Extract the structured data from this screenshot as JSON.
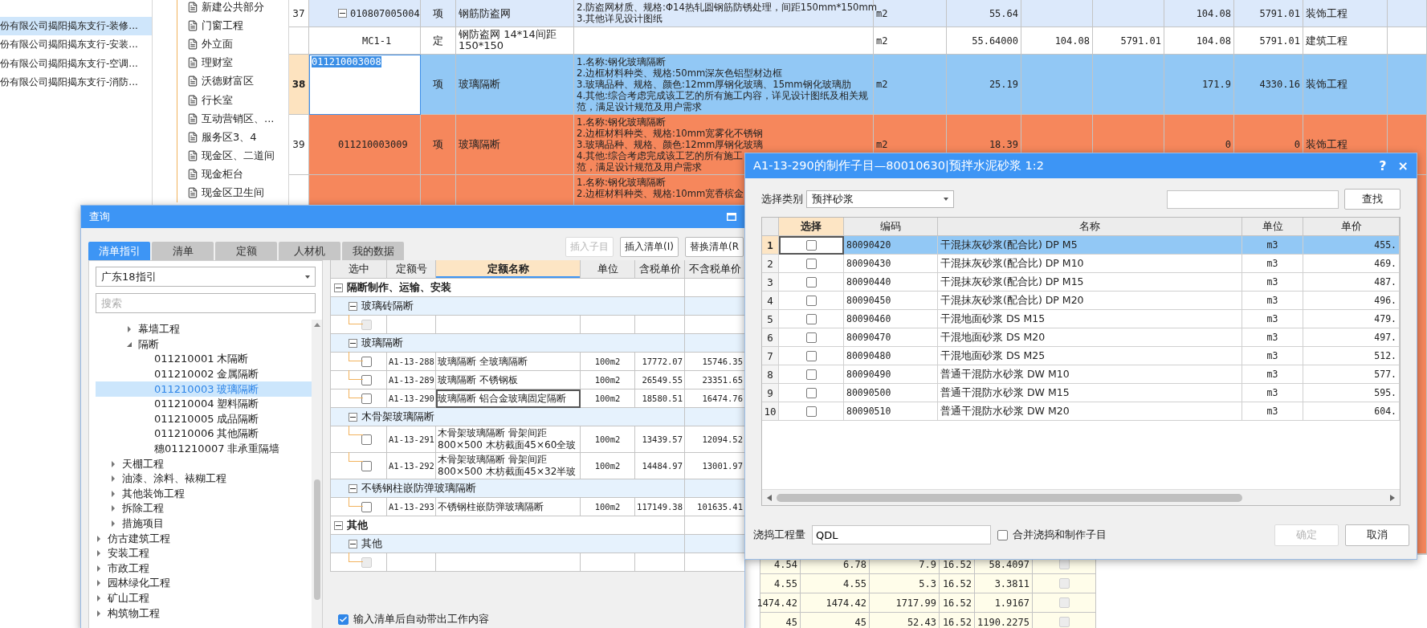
{
  "project_list": {
    "items": [
      {
        "label": "份有限公司揭阳揭东支行-装修...",
        "selected": true
      },
      {
        "label": "份有限公司揭阳揭东支行-安装...",
        "selected": false
      },
      {
        "label": "份有限公司揭阳揭东支行-空调...",
        "selected": false
      },
      {
        "label": "份有限公司揭阳揭东支行-消防...",
        "selected": false
      }
    ]
  },
  "section_tree": {
    "items": [
      "新建公共部分",
      "门窗工程",
      "外立面",
      "理财室",
      "沃德财富区",
      "行长室",
      "互动营销区、...",
      "服务区3、4",
      "现金区、二道间",
      "现金柜台",
      "现金区卫生间"
    ]
  },
  "bill_table": {
    "rows": [
      {
        "number": "37",
        "kind": "bill",
        "expanded": true,
        "selected": false,
        "color": "#dce9fb",
        "code": "010807005004",
        "type": "项",
        "name": "钢筋防盗网",
        "description": [
          "2.防盗网材质、规格:Φ14热轧圆钢筋防锈处理，间距150mm*150mm",
          "3.其他详见设计图纸"
        ],
        "unit": "m2",
        "quantity": "55.64",
        "column_10": "104.08",
        "column_11": "5791.01",
        "category": "装饰工程"
      },
      {
        "kind": "quota",
        "selected": false,
        "color": "#ffffff",
        "code": "MC1-1",
        "type": "定",
        "name": "钢防盗网 14*14间距 150*150",
        "description": [],
        "unit": "m2",
        "quantity": "55.64000",
        "column_8": "104.08",
        "column_9": "5791.01",
        "column_10": "104.08",
        "column_11": "5791.01",
        "category": "建筑工程"
      },
      {
        "number": "38",
        "kind": "bill",
        "selected": true,
        "color": "#92c8f5",
        "code": "011210003008",
        "type": "项",
        "name": "玻璃隔断",
        "description": [
          "1.名称:钢化玻璃隔断",
          "2.边框材料种类、规格:50mm深灰色铝型材边框",
          "3.玻璃品种、规格、颜色:12mm厚钢化玻璃、15mm钢化玻璃肋",
          "4.其他:综合考虑完成该工艺的所有施工内容，详见设计图纸及相关规",
          "范，满足设计规范及用户需求"
        ],
        "unit": "m2",
        "quantity": "25.19",
        "column_10": "171.9",
        "column_11": "4330.16",
        "category": "装饰工程"
      },
      {
        "number": "39",
        "kind": "bill",
        "selected": false,
        "color": "#f6875c",
        "code": "011210003009",
        "type": "项",
        "name": "玻璃隔断",
        "description": [
          "1.名称:钢化玻璃隔断",
          "2.边框材料种类、规格:10mm宽雾化不锈钢",
          "3.玻璃品种、规格、颜色:12mm厚钢化玻璃",
          "4.其他:综合考虑完成该工艺的所有施工",
          "范，满足设计规范及用户需求"
        ],
        "unit": "m2",
        "quantity": "18.39",
        "column_10": "0",
        "column_11": "0",
        "category": "装饰工程"
      },
      {
        "kind": "bill",
        "selected": false,
        "color": "#f6875c",
        "description": [
          "1.名称:钢化玻璃隔断",
          "2.边框材料种类、规格:10mm宽香槟金"
        ]
      }
    ]
  },
  "query_dialog": {
    "title": "查询",
    "tabs": [
      {
        "label": "清单指引",
        "selected": true
      },
      {
        "label": "清单",
        "selected": false
      },
      {
        "label": "定额",
        "selected": false
      },
      {
        "label": "人材机",
        "selected": false
      },
      {
        "label": "我的数据",
        "selected": false
      }
    ],
    "buttons": [
      {
        "label": "插入子目",
        "disabled": true
      },
      {
        "label": "插入清单(I)",
        "disabled": false
      },
      {
        "label": "替换清单(R",
        "disabled": false
      }
    ],
    "guide_select": "广东18指引",
    "search": {
      "placeholder": "搜索"
    },
    "tree": {
      "items": [
        {
          "children": [
            {
              "children": [
                {
                  "label": "幕墙工程",
                  "expanded": false,
                  "selected": false
                },
                {
                  "label": "隔断",
                  "expanded": true,
                  "selected": false,
                  "children": [
                    {
                      "code": "011210001",
                      "label": "木隔断",
                      "selected": false
                    },
                    {
                      "code": "011210002",
                      "label": "金属隔断",
                      "selected": false
                    },
                    {
                      "code": "011210003",
                      "label": "玻璃隔断",
                      "selected": true
                    },
                    {
                      "code": "011210004",
                      "label": "塑料隔断",
                      "selected": false
                    },
                    {
                      "code": "011210005",
                      "label": "成品隔断",
                      "selected": false
                    },
                    {
                      "code": "011210006",
                      "label": "其他隔断",
                      "selected": false
                    },
                    {
                      "code": "穗011210007",
                      "label": "非承重隔墙",
                      "selected": false
                    }
                  ]
                }
              ]
            },
            {
              "label": "天棚工程",
              "expanded": false,
              "selected": false
            },
            {
              "label": "油漆、涂料、裱糊工程",
              "expanded": false,
              "selected": false
            },
            {
              "label": "其他装饰工程",
              "expanded": false,
              "selected": false
            },
            {
              "label": "拆除工程",
              "expanded": false,
              "selected": false
            },
            {
              "label": "措施项目",
              "expanded": false,
              "selected": false
            }
          ]
        },
        {
          "label": "仿古建筑工程",
          "expanded": false,
          "selected": false
        },
        {
          "label": "安装工程",
          "expanded": false,
          "selected": false
        },
        {
          "label": "市政工程",
          "expanded": false,
          "selected": false
        },
        {
          "label": "园林绿化工程",
          "expanded": false,
          "selected": false
        },
        {
          "label": "矿山工程",
          "expanded": false,
          "selected": false
        },
        {
          "label": "构筑物工程",
          "expanded": false,
          "selected": false
        }
      ]
    },
    "quota_table": {
      "columns": [
        {
          "label": "选中",
          "highlighted": false
        },
        {
          "label": "定额号",
          "highlighted": false
        },
        {
          "label": "定额名称",
          "highlighted": true
        },
        {
          "label": "单位",
          "highlighted": false
        },
        {
          "label": "含税单价",
          "highlighted": false
        },
        {
          "label": "不含税单价",
          "highlighted": false
        }
      ],
      "rows": [
        {
          "label": "隔断制作、运输、安装",
          "expanded": true,
          "children": [
            {
              "label": "玻璃砖隔断",
              "expanded": true,
              "children": [
                {
                  "kind": "empty",
                  "checked": false
                }
              ]
            },
            {
              "label": "玻璃隔断",
              "expanded": true,
              "children": [
                {
                  "kind": "item",
                  "checked": false,
                  "focused": false,
                  "code": "A1-13-288",
                  "name": "玻璃隔断 全玻璃隔断",
                  "unit": "100m2",
                  "price_with_tax": "17772.07",
                  "price_without_tax": "15746.35"
                },
                {
                  "kind": "item",
                  "checked": false,
                  "focused": false,
                  "code": "A1-13-289",
                  "name": "玻璃隔断 不锈钢板",
                  "unit": "100m2",
                  "price_with_tax": "26549.55",
                  "price_without_tax": "23351.65"
                },
                {
                  "kind": "item",
                  "checked": false,
                  "focused": true,
                  "code": "A1-13-290",
                  "name": "玻璃隔断 铝合金玻璃固定隔断",
                  "unit": "100m2",
                  "price_with_tax": "18580.51",
                  "price_without_tax": "16474.76"
                }
              ]
            },
            {
              "label": "木骨架玻璃隔断",
              "expanded": true,
              "children": [
                {
                  "kind": "item",
                  "checked": false,
                  "focused": false,
                  "code": "A1-13-291",
                  "name": "木骨架玻璃隔断 骨架间距800×500 木枋截面45×60全玻",
                  "unit": "100m2",
                  "price_with_tax": "13439.57",
                  "price_without_tax": "12094.52"
                },
                {
                  "kind": "item",
                  "checked": false,
                  "focused": false,
                  "code": "A1-13-292",
                  "name": "木骨架玻璃隔断 骨架间距800×500 木枋截面45×32半玻",
                  "unit": "100m2",
                  "price_with_tax": "14484.97",
                  "price_without_tax": "13001.97"
                }
              ]
            },
            {
              "label": "不锈钢柱嵌防弹玻璃隔断",
              "expanded": true,
              "children": [
                {
                  "kind": "item",
                  "checked": false,
                  "focused": false,
                  "code": "A1-13-293",
                  "name": "不锈钢柱嵌防弹玻璃隔断",
                  "unit": "100m2",
                  "price_with_tax": "117149.38",
                  "price_without_tax": "101635.41"
                }
              ]
            }
          ]
        },
        {
          "label": "其他",
          "expanded": true,
          "children": [
            {
              "label": "其他",
              "expanded": true,
              "children": [
                {
                  "kind": "empty",
                  "checked": false
                }
              ]
            }
          ]
        }
      ]
    },
    "auto_fill": {
      "label": "输入清单后自动带出工作内容",
      "checked": true
    }
  },
  "sub_dialog": {
    "title": "A1-13-290的制作子目—80010630|预拌水泥砂浆 1:2",
    "help_glyph": "?",
    "close_glyph": "×",
    "category_label": "选择类别",
    "category": "预拌砂浆",
    "find_button": "查找",
    "columns": [
      {
        "label": "选择",
        "highlighted": true
      },
      {
        "label": "编码",
        "highlighted": false
      },
      {
        "label": "名称",
        "highlighted": false
      },
      {
        "label": "单位",
        "highlighted": false
      },
      {
        "label": "单价",
        "highlighted": false
      }
    ],
    "rows": [
      {
        "number": "1",
        "selected": true,
        "checked": false,
        "code": "80090420",
        "name": "干混抹灰砂浆(配合比) DP M5",
        "unit": "m3",
        "price": "455."
      },
      {
        "number": "2",
        "selected": false,
        "checked": false,
        "code": "80090430",
        "name": "干混抹灰砂浆(配合比) DP M10",
        "unit": "m3",
        "price": "469."
      },
      {
        "number": "3",
        "selected": false,
        "checked": false,
        "code": "80090440",
        "name": "干混抹灰砂浆(配合比) DP M15",
        "unit": "m3",
        "price": "487."
      },
      {
        "number": "4",
        "selected": false,
        "checked": false,
        "code": "80090450",
        "name": "干混抹灰砂浆(配合比) DP M20",
        "unit": "m3",
        "price": "496."
      },
      {
        "number": "5",
        "selected": false,
        "checked": false,
        "code": "80090460",
        "name": "干混地面砂浆 DS M15",
        "unit": "m3",
        "price": "479."
      },
      {
        "number": "6",
        "selected": false,
        "checked": false,
        "code": "80090470",
        "name": "干混地面砂浆 DS M20",
        "unit": "m3",
        "price": "497."
      },
      {
        "number": "7",
        "selected": false,
        "checked": false,
        "code": "80090480",
        "name": "干混地面砂浆 DS M25",
        "unit": "m3",
        "price": "512."
      },
      {
        "number": "8",
        "selected": false,
        "checked": false,
        "code": "80090490",
        "name": "普通干混防水砂浆 DW M10",
        "unit": "m3",
        "price": "577."
      },
      {
        "number": "9",
        "selected": false,
        "checked": false,
        "code": "80090500",
        "name": "普通干混防水砂浆 DW M15",
        "unit": "m3",
        "price": "595."
      },
      {
        "number": "10",
        "selected": false,
        "checked": false,
        "code": "80090510",
        "name": "普通干混防水砂浆 DW M20",
        "unit": "m3",
        "price": "604."
      }
    ],
    "quantity_label": "浇捣工程量",
    "quantity_value": "QDL",
    "merge": {
      "label": "合并浇捣和制作子目",
      "checked": false
    },
    "buttons": [
      {
        "label": "确定",
        "disabled": true
      },
      {
        "label": "取消",
        "disabled": false
      }
    ]
  },
  "detail_table": {
    "rows": [
      {
        "cells": [
          "4.54",
          "6.78",
          "7.9",
          "16.52",
          "58.4097"
        ],
        "checked": false
      },
      {
        "cells": [
          "4.55",
          "4.55",
          "5.3",
          "16.52",
          "3.3811"
        ],
        "checked": false
      },
      {
        "cells": [
          "1474.42",
          "1474.42",
          "1717.99",
          "16.52",
          "1.9167"
        ],
        "checked": false
      },
      {
        "cells": [
          "45",
          "45",
          "52.43",
          "16.52",
          "1190.2275"
        ],
        "checked": false
      }
    ]
  }
}
